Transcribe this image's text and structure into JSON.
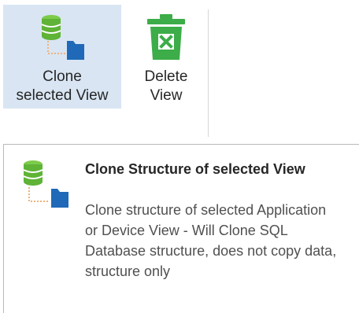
{
  "ribbon": {
    "clone_button": {
      "label_line1": "Clone",
      "label_line2": "selected View",
      "icon": "clone-view-icon"
    },
    "delete_button": {
      "label_line1": "Delete",
      "label_line2": "View",
      "icon": "delete-bin-icon"
    }
  },
  "tooltip": {
    "title": "Clone Structure of selected View",
    "description": "Clone structure of selected Application or Device View - Will Clone SQL Database structure, does not copy data, structure only",
    "icon": "clone-view-icon"
  },
  "colors": {
    "selected_background": "#d9e5f3",
    "database_green": "#5fb336",
    "folder_blue": "#1f69b8",
    "bin_green": "#3cad48"
  }
}
